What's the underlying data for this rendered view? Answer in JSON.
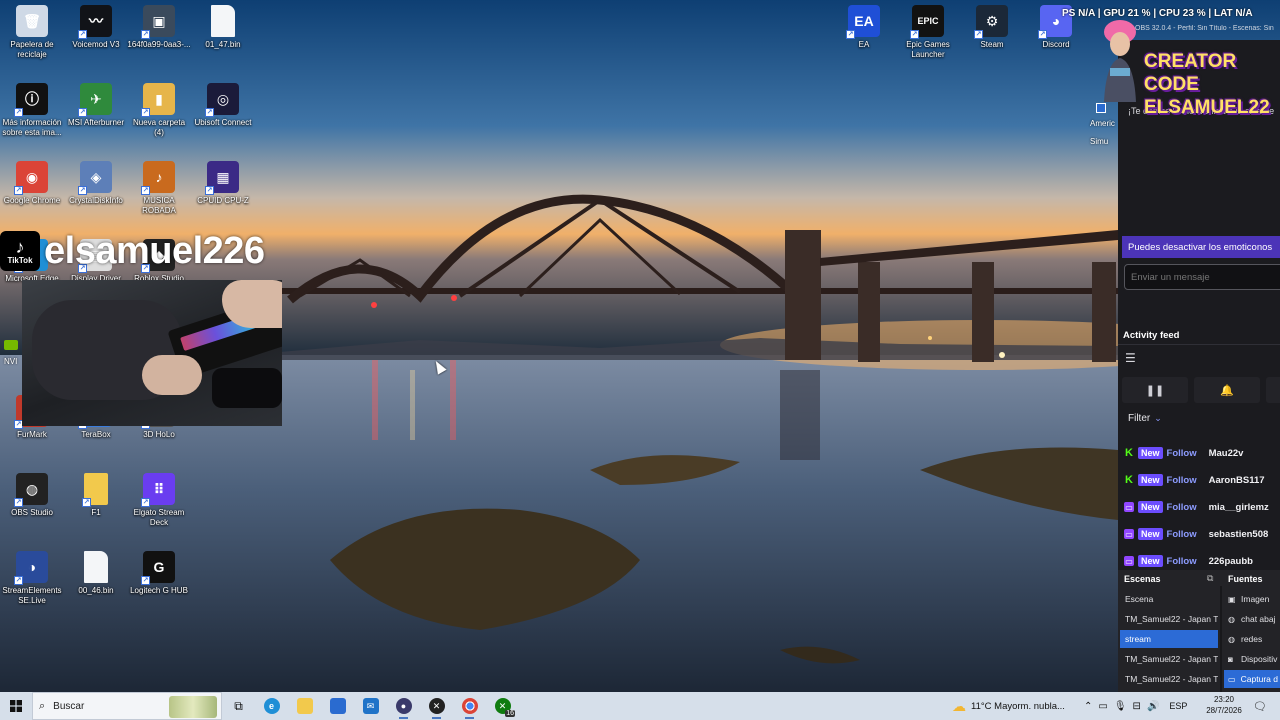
{
  "desktop_icons": [
    {
      "label": "Papelera de reciclaje",
      "icon": "recycle-bin-icon",
      "color": "#cfd9e6"
    },
    {
      "label": "Voicemod V3",
      "icon": "voicemod-icon",
      "color": "#111318"
    },
    {
      "label": "164f0a99-0aa3-...",
      "icon": "image-file-icon",
      "color": "#3a4a5c"
    },
    {
      "label": "01_47.bin",
      "icon": "file-icon",
      "color": "#f4f6f8"
    },
    {
      "label": "Más información sobre esta ima...",
      "icon": "info-icon",
      "color": "#111"
    },
    {
      "label": "MSI Afterburner",
      "icon": "msi-afterburner-icon",
      "color": "#2f8a3c"
    },
    {
      "label": "Nueva carpeta (4)",
      "icon": "folder-image-icon",
      "color": "#e6b54a"
    },
    {
      "label": "Ubisoft Connect",
      "icon": "ubisoft-icon",
      "color": "#1b1b3a"
    },
    {
      "label": "Google Chrome",
      "icon": "chrome-icon",
      "color": "#db4437"
    },
    {
      "label": "CrystalDiskInfo",
      "icon": "crystaldisk-icon",
      "color": "#5d7fb8"
    },
    {
      "label": "MUSICA ROBADA",
      "icon": "music-folder-icon",
      "color": "#c96a1e"
    },
    {
      "label": "CPUID CPU-Z",
      "icon": "cpuz-icon",
      "color": "#3b2a86"
    },
    {
      "label": "Microsoft Edge",
      "icon": "edge-icon",
      "color": "#1f8fd6"
    },
    {
      "label": "Display Driver",
      "icon": "display-driver-icon",
      "color": "#ddd"
    },
    {
      "label": "Roblox Studio",
      "icon": "roblox-icon",
      "color": "#222"
    },
    {
      "label": "FurMark",
      "icon": "furmark-icon",
      "color": "#c0392b"
    },
    {
      "label": "TeraBox",
      "icon": "terabox-icon",
      "color": "#3b7ddd"
    },
    {
      "label": "3D HoLo",
      "icon": "holo-icon",
      "color": "#555"
    },
    {
      "label": "OBS Studio",
      "icon": "obs-icon",
      "color": "#222"
    },
    {
      "label": "F1",
      "icon": "folder-icon",
      "color": "#f2c94c"
    },
    {
      "label": "Elgato Stream Deck",
      "icon": "stream-deck-icon",
      "color": "#6a3df0"
    },
    {
      "label": "StreamElements SE.Live",
      "icon": "streamelements-icon",
      "color": "#2a4b9b"
    },
    {
      "label": "00_46.bin",
      "icon": "file-icon",
      "color": "#f4f6f8"
    },
    {
      "label": "Logitech G HUB",
      "icon": "logitech-icon",
      "color": "#111"
    },
    {
      "label": "EA",
      "icon": "ea-icon",
      "color": "#1f4fd6"
    },
    {
      "label": "Epic Games Launcher",
      "icon": "epic-games-icon",
      "color": "#121212"
    },
    {
      "label": "Steam",
      "icon": "steam-icon",
      "color": "#1b2838"
    },
    {
      "label": "Discord",
      "icon": "discord-icon",
      "color": "#5865f2"
    }
  ],
  "partial_icon_labels": {
    "nvidia": "NVI",
    "american": "Americ\nSimu"
  },
  "overlay": {
    "tiktok_logo_text": "TikTok",
    "tiktok_username": "elsamuel226",
    "creator_code_line1": "CREATOR CODE",
    "creator_code_line2": "ELSAMUEL22"
  },
  "system_stats": "PS  N/A  |  GPU 21 %  |  CPU 23 %  |  LAT N/A",
  "obs_window_title": "OBS 32.0.4 - Perfil: Sin Título - Escenas: Sin",
  "right_panel": {
    "chat_welcome": "¡Te damos la bienvenida a la sala de",
    "emote_notice": "Puedes desactivar los emoticonos",
    "chat_placeholder": "Enviar un mensaje",
    "activity_title": "Activity feed",
    "filter_label": "Filter",
    "events": [
      {
        "platform": "kick",
        "badge": "New",
        "type": "Follow",
        "user": "Mau22v"
      },
      {
        "platform": "kick",
        "badge": "New",
        "type": "Follow",
        "user": "AaronBS117"
      },
      {
        "platform": "twitch",
        "badge": "New",
        "type": "Follow",
        "user": "mia__girlemz"
      },
      {
        "platform": "twitch",
        "badge": "New",
        "type": "Follow",
        "user": "sebastien508"
      },
      {
        "platform": "twitch",
        "badge": "New",
        "type": "Follow",
        "user": "226paubb"
      }
    ],
    "scenes_title": "Escenas",
    "sources_title": "Fuentes",
    "scenes": [
      {
        "label": "Escena",
        "selected": false
      },
      {
        "label": "TM_Samuel22 - Japan Tl",
        "selected": false
      },
      {
        "label": "stream",
        "selected": true
      },
      {
        "label": "TM_Samuel22 - Japan Tl",
        "selected": false
      },
      {
        "label": "TM_Samuel22 - Japan Tl",
        "selected": false
      }
    ],
    "sources": [
      {
        "label": "Imagen",
        "icon": "image-icon",
        "selected": false
      },
      {
        "label": "chat abaj",
        "icon": "globe-icon",
        "selected": false
      },
      {
        "label": "redes",
        "icon": "globe-icon",
        "selected": false
      },
      {
        "label": "Dispositiv",
        "icon": "camera-icon",
        "selected": false
      },
      {
        "label": "Captura d",
        "icon": "monitor-icon",
        "selected": true
      }
    ]
  },
  "taskbar": {
    "search_placeholder": "Buscar",
    "weather": "11°C  Mayorm. nubla...",
    "language": "ESP",
    "time": "23:20",
    "date": "28/7/2026",
    "notif_count": "16"
  },
  "colors": {
    "accent": "#6c4dff",
    "twitch": "#9146ff",
    "kick": "#53fc18",
    "obs_selected": "#2c6bd6",
    "taskbar": "#d6dfea"
  }
}
